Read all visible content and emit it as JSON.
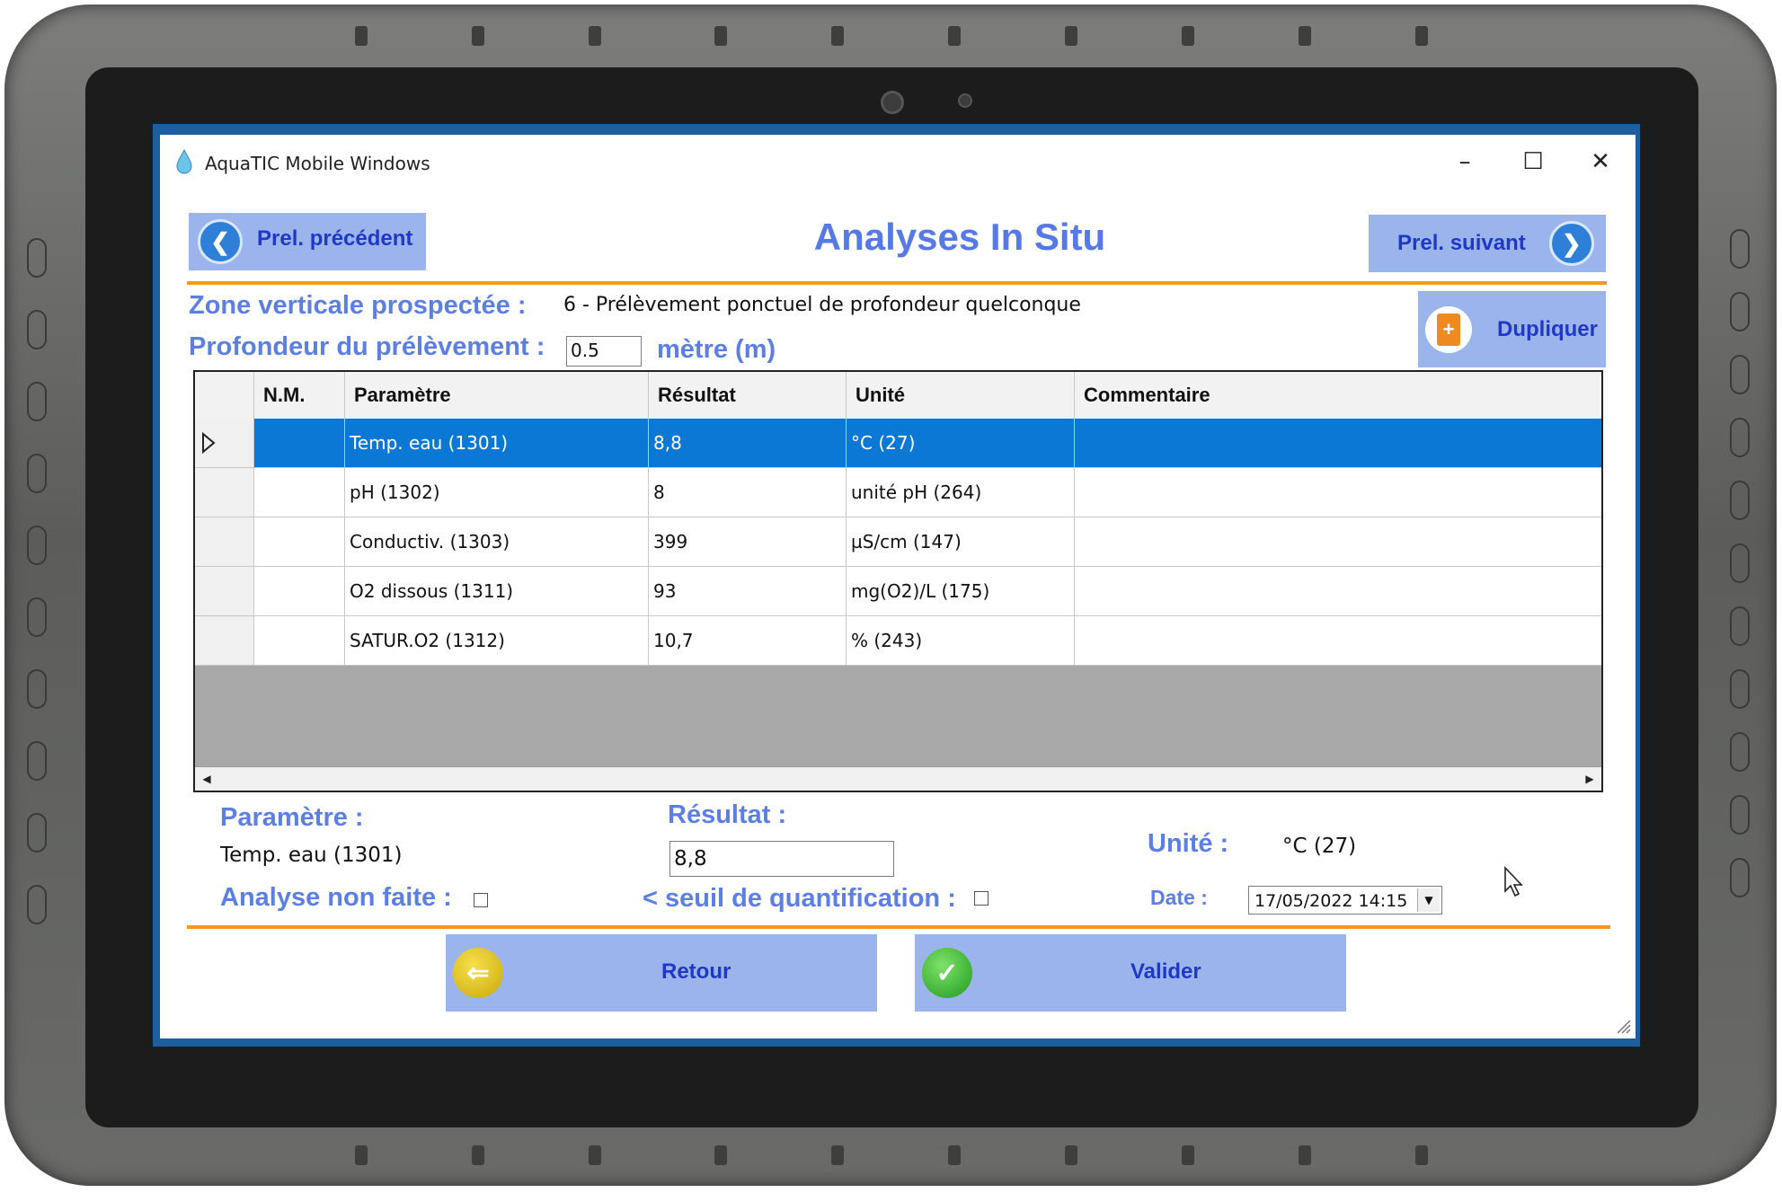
{
  "window": {
    "title": "AquaTIC Mobile Windows"
  },
  "title_controls": {
    "minimize": "–",
    "maximize": "☐",
    "close": "✕"
  },
  "nav": {
    "prev_label": "Prel. précédent",
    "next_label": "Prel. suivant"
  },
  "page_title": "Analyses In Situ",
  "zone": {
    "label": "Zone verticale prospectée :",
    "value": "6 - Prélèvement ponctuel de profondeur quelconque"
  },
  "depth": {
    "label": "Profondeur du prélèvement :",
    "value": "0.5",
    "unit": "mètre (m)"
  },
  "duplicate_label": "Dupliquer",
  "grid": {
    "columns": [
      "N.M.",
      "Paramètre",
      "Résultat",
      "Unité",
      "Commentaire"
    ],
    "rows": [
      {
        "nm": "",
        "param": "Temp. eau (1301)",
        "result": "8,8",
        "unit": "°C (27)",
        "comment": ""
      },
      {
        "nm": "",
        "param": "pH (1302)",
        "result": "8",
        "unit": "unité pH (264)",
        "comment": ""
      },
      {
        "nm": "",
        "param": "Conductiv. (1303)",
        "result": "399",
        "unit": "µS/cm (147)",
        "comment": ""
      },
      {
        "nm": "",
        "param": "O2 dissous (1311)",
        "result": "93",
        "unit": "mg(O2)/L (175)",
        "comment": ""
      },
      {
        "nm": "",
        "param": "SATUR.O2 (1312)",
        "result": "10,7",
        "unit": "% (243)",
        "comment": ""
      }
    ],
    "selected_row": 0
  },
  "detail": {
    "param_label": "Paramètre :",
    "param_value": "Temp. eau (1301)",
    "result_label": "Résultat :",
    "result_value": "8,8",
    "unit_label": "Unité :",
    "unit_value": "°C (27)",
    "not_done_label": "Analyse non faite :",
    "threshold_label": "< seuil de quantification :",
    "date_label": "Date :",
    "date_value": "17/05/2022 14:15"
  },
  "buttons": {
    "back": "Retour",
    "validate": "Valider"
  },
  "colors": {
    "accent_blue": "#5d7fe2",
    "button_bg": "#9bb5ec",
    "button_text": "#1f39c4",
    "orange_line": "#f59a1d",
    "selection": "#0a78d4"
  }
}
